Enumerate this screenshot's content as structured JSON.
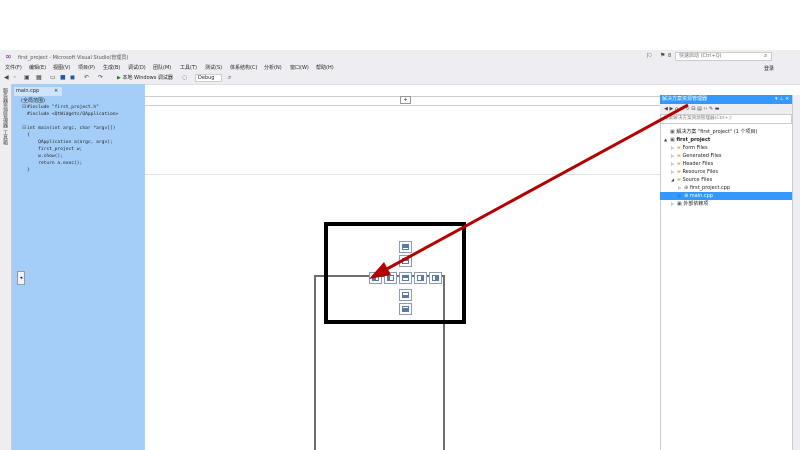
{
  "window": {
    "title": "first_project - Microsoft Visual Studio(管理员)",
    "quick_launch_placeholder": "快速启动 (Ctrl+Q)",
    "notification_count": "8",
    "login_label": "登录"
  },
  "menu": [
    {
      "label": "文件(F)"
    },
    {
      "label": "编辑(E)"
    },
    {
      "label": "视图(V)"
    },
    {
      "label": "项目(P)"
    },
    {
      "label": "生成(B)"
    },
    {
      "label": "调试(D)"
    },
    {
      "label": "团队(M)"
    },
    {
      "label": "工具(T)"
    },
    {
      "label": "测试(S)"
    },
    {
      "label": "体系结构(C)"
    },
    {
      "label": "分析(N)"
    },
    {
      "label": "窗口(W)"
    },
    {
      "label": "帮助(H)"
    }
  ],
  "toolbar": {
    "run_label": "本地 Windows 调试器",
    "config_value": "Debug"
  },
  "left_tabs": [
    {
      "label": "服务器资源管理器"
    },
    {
      "label": "工具箱"
    }
  ],
  "editor": {
    "tab_label": "main.cpp",
    "tab_close": "×",
    "scope_label": "(全局范围)",
    "code_lines": [
      "#include \"first_project.h\"",
      "#include <QtWidgets/QApplication>",
      "",
      "int main(int argc, char *argv[])",
      "{",
      "    QApplication a(argc, argv);",
      "    first_project w;",
      "    w.show();",
      "    return a.exec();",
      "}"
    ]
  },
  "solution_explorer": {
    "title": "解决方案资源管理器",
    "search_placeholder": "搜索解决方案资源管理器(Ctrl+;)",
    "tree": [
      {
        "label": "解决方案 \"first_project\" (1 个项目)",
        "indent": 0,
        "expander": "",
        "icon": "solution-icon",
        "bold": false
      },
      {
        "label": "first_project",
        "indent": 0,
        "expander": "▲",
        "icon": "project-icon",
        "bold": true
      },
      {
        "label": "Form Files",
        "indent": 1,
        "expander": "▷",
        "icon": "folder-icon",
        "bold": false
      },
      {
        "label": "Generated Files",
        "indent": 1,
        "expander": "▷",
        "icon": "folder-icon",
        "bold": false
      },
      {
        "label": "Header Files",
        "indent": 1,
        "expander": "▷",
        "icon": "folder-icon",
        "bold": false
      },
      {
        "label": "Resource Files",
        "indent": 1,
        "expander": "▷",
        "icon": "folder-icon",
        "bold": false
      },
      {
        "label": "Source Files",
        "indent": 1,
        "expander": "◢",
        "icon": "folder-icon",
        "bold": false
      },
      {
        "label": "first_project.cpp",
        "indent": 2,
        "expander": "▷",
        "icon": "cpp-file-icon",
        "bold": false
      },
      {
        "label": "main.cpp",
        "indent": 2,
        "expander": "▷",
        "icon": "cpp-file-icon",
        "bold": false,
        "selected": true
      },
      {
        "label": "外部依赖项",
        "indent": 1,
        "expander": "▷",
        "icon": "dependencies-icon",
        "bold": false
      }
    ]
  },
  "colors": {
    "accent_blue": "#3399ff",
    "dock_preview_blue": "#a4cef7",
    "annotation_arrow": "#b30000",
    "highlight_box": "#000000"
  }
}
